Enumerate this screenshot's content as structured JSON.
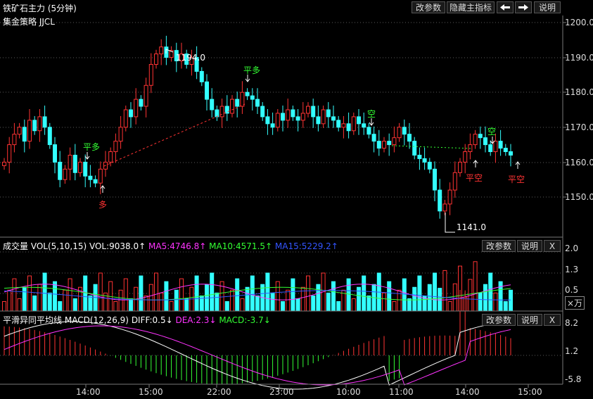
{
  "window": {
    "title": "铁矿石主力 (5分钟)"
  },
  "strategy": {
    "label": "集金策略 JJCL"
  },
  "toolbar": {
    "params": "改参数",
    "hide_indicator": "隐藏主指标",
    "left_arrow_icon": "arrow-left-icon",
    "right_arrow_icon": "arrow-right-icon",
    "help": "说明"
  },
  "price_panel": {
    "y_ticks": [
      "1200.0",
      "1190.0",
      "1180.0",
      "1170.0",
      "1160.0",
      "1150.0"
    ],
    "high_label": "1194.0",
    "low_label": "1141.0",
    "signals": [
      {
        "text": "平多",
        "color": "#33ff33"
      },
      {
        "text": "多",
        "color": "#ff3333"
      },
      {
        "text": "平多",
        "color": "#33ff33"
      },
      {
        "text": "空",
        "color": "#33ff33"
      },
      {
        "text": "平空",
        "color": "#ff3333"
      },
      {
        "text": "空",
        "color": "#33ff33"
      },
      {
        "text": "平空",
        "color": "#ff3333"
      }
    ]
  },
  "volume_panel": {
    "name": "成交量",
    "params": "VOL(5,10,15)",
    "vol": "VOL:9038.0",
    "ma5": "MA5:4746.8",
    "ma10": "MA10:4571.5",
    "ma15": "MA15:5229.2",
    "y_ticks": [
      "2.0",
      "1.3",
      "0.5"
    ],
    "unit": "×万",
    "btn_params": "改参数",
    "btn_help": "说明",
    "btn_close": "X"
  },
  "macd_panel": {
    "name": "平滑异同平均线",
    "params": "MACD(12,26,9)",
    "diff": "DIFF:0.5",
    "dea": "DEA:2.3",
    "macd": "MACD:-3.7",
    "y_ticks": [
      "8.2",
      "1.2",
      "-5.8"
    ],
    "btn_params": "改参数",
    "btn_help": "说明",
    "btn_close": "X"
  },
  "x_axis": {
    "labels": [
      "14:00",
      "15:00",
      "22:00",
      "23:00",
      "10:00",
      "11:00",
      "14:00",
      "15:00"
    ]
  },
  "colors": {
    "up": "#ff3333",
    "down": "#33ffff",
    "ma5": "#ffffff",
    "ma10": "#ffff00",
    "ma15": "#ff00ff",
    "diff": "#ffffff",
    "dea": "#ff00ff",
    "grid": "#5a5a5a",
    "axis": "#777777"
  }
}
